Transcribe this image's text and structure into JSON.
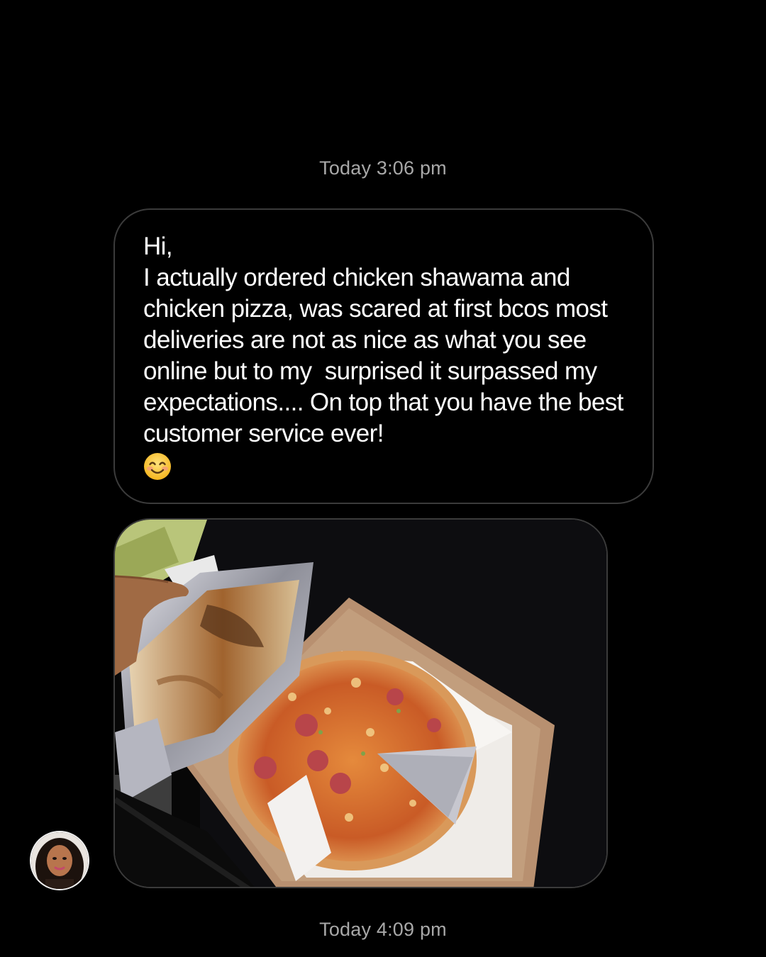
{
  "conversation": {
    "timestamp_top": "Today 3:06 pm",
    "message": {
      "text": "Hi,\nI actually ordered chicken shawama and chicken pizza, was scared at first bcos most deliveries are not as nice as what you see online but to my  surprised it surpassed my expectations.... On top that you have the best customer service ever!",
      "emoji": "smiling-face-icon"
    },
    "photo": {
      "subject": "shawarma-in-foil-and-pizza-in-box-image"
    },
    "timestamp_bottom": "Today 4:09 pm"
  },
  "sender": {
    "avatar": "avatar-icon"
  },
  "colors": {
    "background": "#000000",
    "timestamp": "#a8a8a8",
    "bubble_border": "#3b3b3b",
    "message_text": "#ffffff"
  }
}
